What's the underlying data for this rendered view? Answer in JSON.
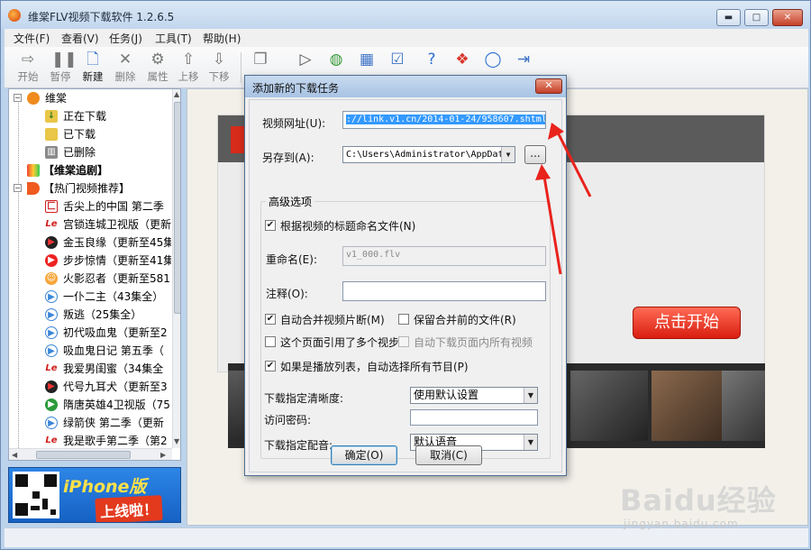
{
  "window": {
    "title": "维棠FLV视频下载软件 1.2.6.5",
    "controls": {
      "minimize": "▬",
      "maximize": "□",
      "close": "✕"
    }
  },
  "menu": [
    "文件(F)",
    "查看(V)",
    "任务(J)",
    "工具(T)",
    "帮助(H)"
  ],
  "toolbar": [
    {
      "label": "开始",
      "icon": "play-arrow-icon"
    },
    {
      "label": "暂停",
      "icon": "pause-icon"
    },
    {
      "label": "新建",
      "icon": "new-document-icon"
    },
    {
      "label": "删除",
      "icon": "delete-icon"
    },
    {
      "label": "属性",
      "icon": "properties-icon"
    },
    {
      "label": "上移",
      "icon": "move-up-icon"
    },
    {
      "label": "下移",
      "icon": "move-down-icon"
    }
  ],
  "tree": {
    "root": "维棠",
    "downloading": "正在下载",
    "downloaded": "已下载",
    "deleted": "已删除",
    "follow": "【维棠追剧】",
    "hot": "【热门视频推荐】",
    "items": [
      "舌尖上的中国 第二季",
      "宫锁连城卫视版（更新",
      "金玉良缘（更新至45集",
      "步步惊情（更新至41集",
      "火影忍者（更新至581",
      "一仆二主（43集全）",
      "叛逃（25集全）",
      "初代吸血鬼（更新至2",
      "吸血鬼日记 第五季（",
      "我爱男闺蜜（34集全",
      "代号九耳犬（更新至3",
      "隋唐英雄4卫视版（75",
      "绿箭侠 第二季（更新",
      "我是歌手第二季（第2"
    ]
  },
  "banner": {
    "title": "iPhone版",
    "subtitle": "上线啦！"
  },
  "content": {
    "start_button": "点击开始"
  },
  "watermark": {
    "logo": "Baidu经验",
    "site": "jingyan.baidu.com"
  },
  "dialog": {
    "title": "添加新的下载任务",
    "close": "✕",
    "url_label": "视频网址(U):",
    "url_value": "://link.v1.cn/2014-01-24/958607.shtml",
    "saveto_label": "另存到(A):",
    "saveto_value": "C:\\Users\\Administrator\\AppDat",
    "browse": "...",
    "advanced": "高级选项",
    "name_by_title": "根据视频的标题命名文件(N)",
    "rename_label": "重命名(E):",
    "rename_value": "v1_000.flv",
    "note_label": "注释(O):",
    "note_value": "",
    "auto_merge": "自动合并视频片断(M)",
    "keep_before_merge": "保留合并前的文件(R)",
    "multi_video": "这个页面引用了多个视步",
    "download_all": "自动下载页面内所有视频",
    "playlist": "如果是播放列表，自动选择所有节目(P)",
    "quality_label": "下载指定清晰度:",
    "quality_value": "使用默认设置",
    "password_label": "访问密码:",
    "password_value": "",
    "audio_label": "下载指定配音:",
    "audio_value": "默认语音",
    "ok": "确定(O)",
    "cancel": "取消(C)",
    "checks": {
      "name_by_title": true,
      "auto_merge": true,
      "keep_before_merge": false,
      "multi_video": false,
      "download_all": false,
      "playlist": true
    }
  },
  "colors": {
    "selection": "#3399ff",
    "annotation_arrow": "#e8231c",
    "start_button": "#e0281a"
  }
}
